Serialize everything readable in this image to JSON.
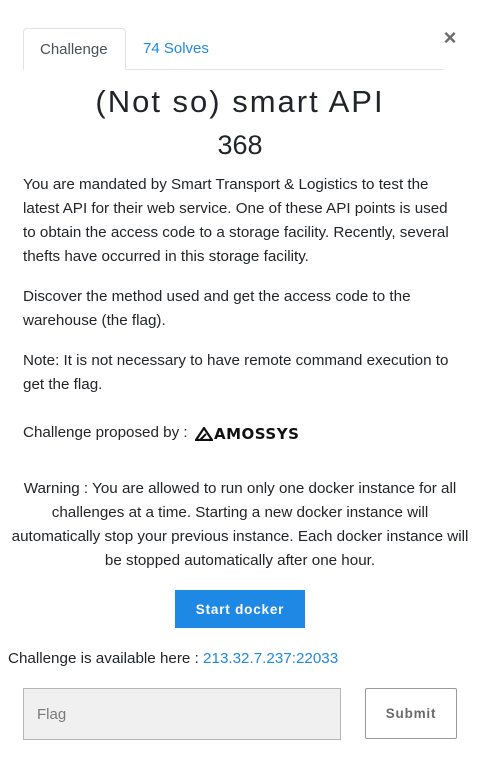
{
  "modal": {
    "close_label": "×",
    "tabs": [
      {
        "label": "Challenge"
      },
      {
        "label": "74 Solves"
      }
    ],
    "title": "(Not so) smart API",
    "value": "368",
    "description": [
      "You are mandated by Smart Transport & Logistics to test the latest API for their web service. One of these API points is used to obtain the access code to a storage facility. Recently, several thefts have occurred in this storage facility.",
      "Discover the method used and get the access code to the warehouse (the flag).",
      "Note: It is not necessary to have remote command execution to get the flag."
    ],
    "proposed_label": "Challenge proposed by :",
    "proposer_logo_text": "AMOSSYS",
    "warning": "Warning : You are allowed to run only one docker instance for all challenges at a time. Starting a new docker instance will automatically stop your previous instance. Each docker instance will be stopped automatically after one hour.",
    "start_docker_label": "Start docker",
    "available_label": "Challenge is available here :",
    "available_link": "213.32.7.237:22033",
    "flag_placeholder": "Flag",
    "submit_label": "Submit"
  },
  "colors": {
    "accent": "#1e88e5"
  }
}
